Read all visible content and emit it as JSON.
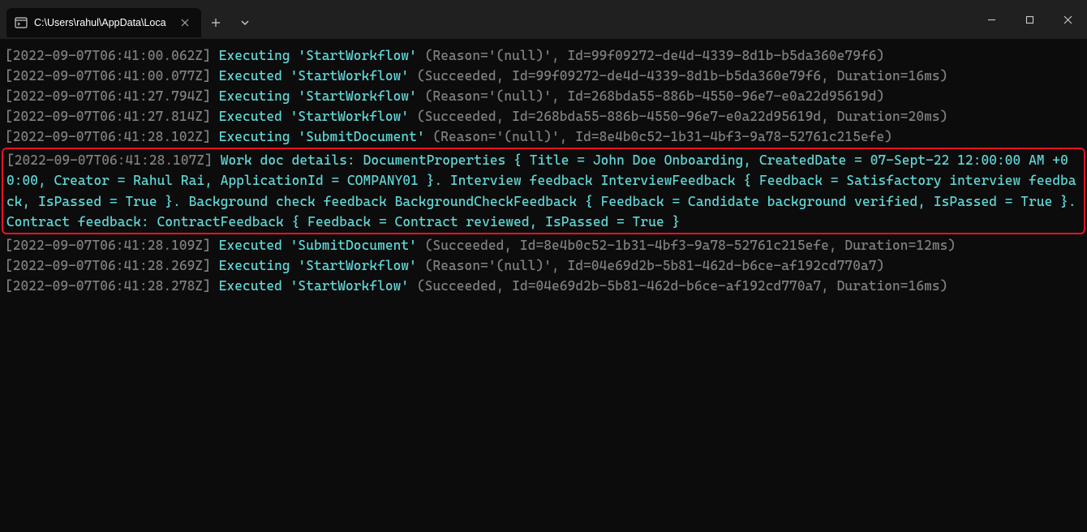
{
  "window": {
    "tab_title": "C:\\Users\\rahul\\AppData\\Loca"
  },
  "logs": {
    "l1_ts": "[2022-09-07T06:41:00.062Z]",
    "l1_a": "Executing 'StartWorkflow'",
    "l1_b": " (Reason='(null)', Id=99f09272-de4d-4339-8d1b-b5da360e79f6)",
    "l2_ts": "[2022-09-07T06:41:00.077Z]",
    "l2_a": "Executed 'StartWorkflow'",
    "l2_b": " (Succeeded, Id=99f09272-de4d-4339-8d1b-b5da360e79f6, Duration=16ms)",
    "l3_ts": "[2022-09-07T06:41:27.794Z]",
    "l3_a": "Executing 'StartWorkflow'",
    "l3_b": " (Reason='(null)', Id=268bda55-886b-4550-96e7-e0a22d95619d)",
    "l4_ts": "[2022-09-07T06:41:27.814Z]",
    "l4_a": "Executed 'StartWorkflow'",
    "l4_b": " (Succeeded, Id=268bda55-886b-4550-96e7-e0a22d95619d, Duration=20ms)",
    "l5_ts": "[2022-09-07T06:41:28.102Z]",
    "l5_a": "Executing 'SubmitDocument'",
    "l5_b": " (Reason='(null)', Id=8e4b0c52-1b31-4bf3-9a78-52761c215efe)",
    "l6_ts": "[2022-09-07T06:41:28.107Z]",
    "l6_body": "Work doc details: DocumentProperties { Title = John Doe Onboarding, CreatedDate = 07-Sept-22 12:00:00 AM +00:00, Creator = Rahul Rai, ApplicationId = COMPANY01 }. Interview feedback InterviewFeedback { Feedback = Satisfactory interview feedback, IsPassed = True }. Background check feedback BackgroundCheckFeedback { Feedback = Candidate background verified, IsPassed = True }. Contract feedback: ContractFeedback { Feedback = Contract reviewed, IsPassed = True }",
    "l7_ts": "[2022-09-07T06:41:28.109Z]",
    "l7_a": "Executed 'SubmitDocument'",
    "l7_b": " (Succeeded, Id=8e4b0c52-1b31-4bf3-9a78-52761c215efe, Duration=12ms)",
    "l8_ts": "[2022-09-07T06:41:28.269Z]",
    "l8_a": "Executing 'StartWorkflow'",
    "l8_b": " (Reason='(null)', Id=04e69d2b-5b81-462d-b6ce-af192cd770a7)",
    "l9_ts": "[2022-09-07T06:41:28.278Z]",
    "l9_a": "Executed 'StartWorkflow'",
    "l9_b": " (Succeeded, Id=04e69d2b-5b81-462d-b6ce-af192cd770a7, Duration=16ms)"
  }
}
